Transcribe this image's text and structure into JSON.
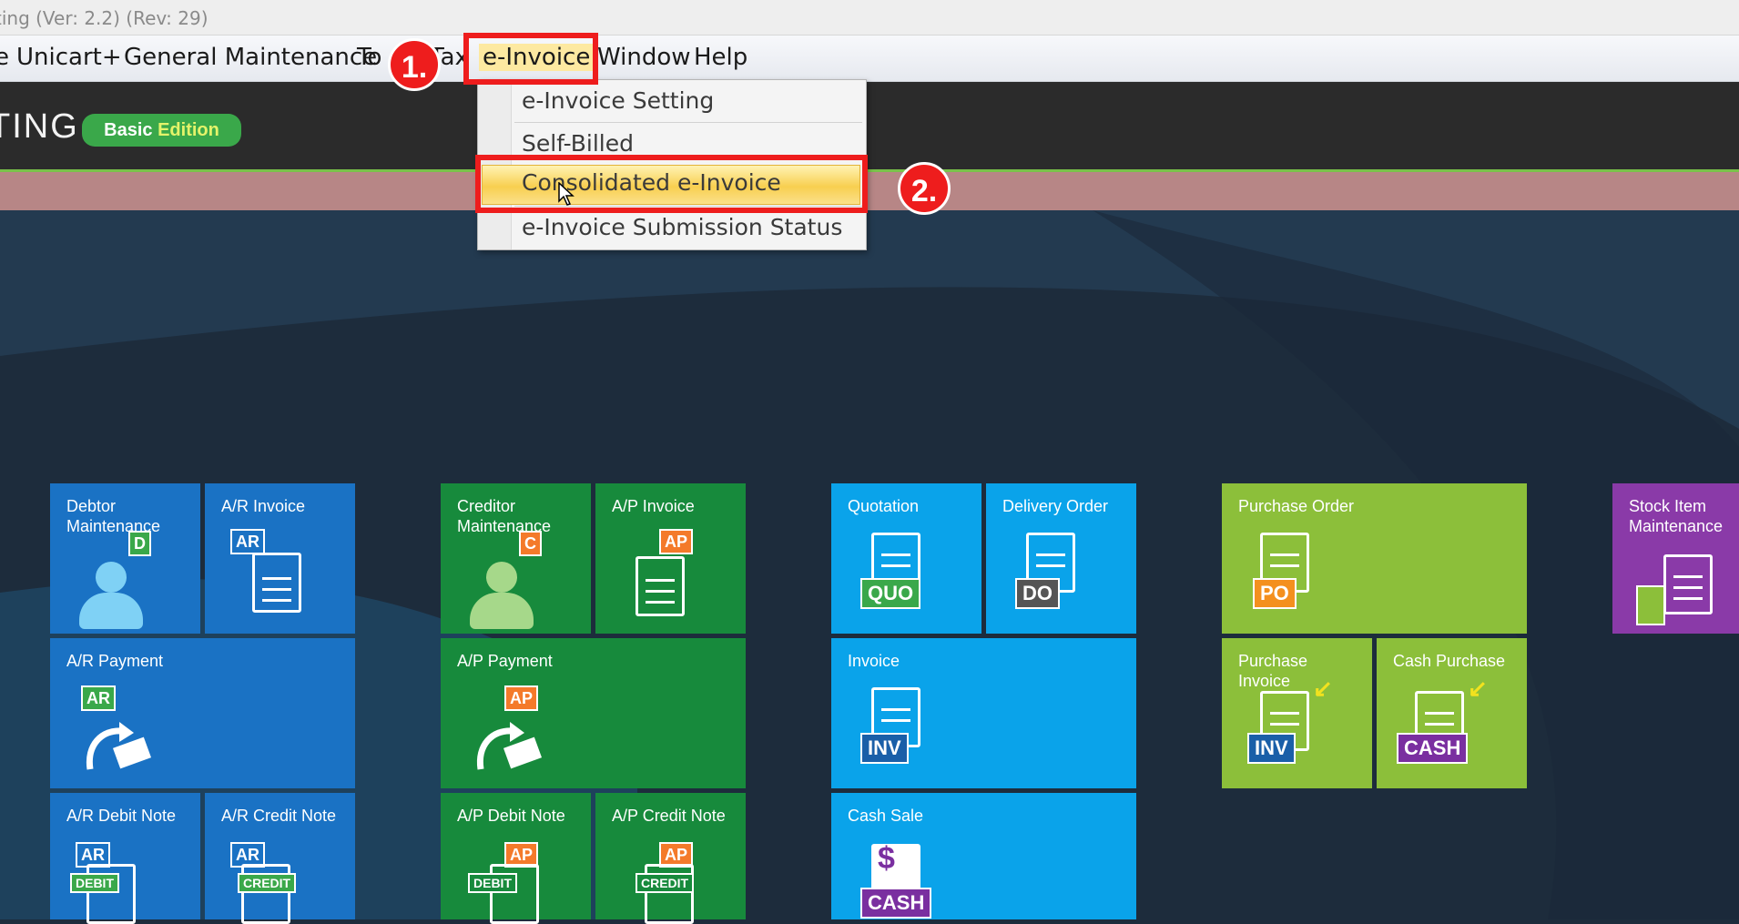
{
  "window": {
    "title": "ting (Ver: 2.2) (Rev: 29)"
  },
  "menu": {
    "items": [
      "e",
      "Unicart+",
      "General Maintenance",
      "To",
      "Tax",
      "e-Invoice",
      "Window",
      "Help"
    ],
    "active": "e-Invoice"
  },
  "header": {
    "logo_text": "TING",
    "badge_part1": "Basic",
    "badge_part2": "Edition"
  },
  "dropdown": {
    "items": [
      "e-Invoice Setting",
      "Self-Billed",
      "Consolidated e-Invoice",
      "e-Invoice Submission Status"
    ],
    "highlighted": "Consolidated e-Invoice"
  },
  "annotations": {
    "step1": "1.",
    "step2": "2."
  },
  "tiles": {
    "debtor": {
      "label": "Debtor Maintenance",
      "tag": "D"
    },
    "ar_invoice": {
      "label": "A/R Invoice",
      "tag": "AR"
    },
    "ar_payment": {
      "label": "A/R Payment",
      "tag": "AR"
    },
    "ar_debit": {
      "label": "A/R Debit Note",
      "tag": "AR",
      "sub": "DEBIT"
    },
    "ar_credit": {
      "label": "A/R Credit Note",
      "tag": "AR",
      "sub": "CREDIT"
    },
    "creditor": {
      "label": "Creditor Maintenance",
      "tag": "C"
    },
    "ap_invoice": {
      "label": "A/P Invoice",
      "tag": "AP"
    },
    "ap_payment": {
      "label": "A/P Payment",
      "tag": "AP"
    },
    "ap_debit": {
      "label": "A/P Debit Note",
      "tag": "AP",
      "sub": "DEBIT"
    },
    "ap_credit": {
      "label": "A/P Credit Note",
      "tag": "AP",
      "sub": "CREDIT"
    },
    "quotation": {
      "label": "Quotation",
      "tag": "QUO"
    },
    "delivery": {
      "label": "Delivery Order",
      "tag": "DO"
    },
    "invoice": {
      "label": "Invoice",
      "tag": "INV"
    },
    "cash_sale": {
      "label": "Cash Sale",
      "tag": "CASH"
    },
    "purchase_order": {
      "label": "Purchase Order",
      "tag": "PO"
    },
    "purchase_invoice": {
      "label": "Purchase Invoice",
      "tag": "INV"
    },
    "cash_purchase": {
      "label": "Cash Purchase",
      "tag": "CASH"
    },
    "stock_item": {
      "label": "Stock Item Maintenance"
    }
  },
  "colors": {
    "ar_blue": "#1a72c4",
    "ap_green": "#178a3c",
    "sales_cyan": "#0aa3ea",
    "purchase_lime": "#8cbf3a",
    "stock_purple": "#8a3aa8",
    "annotation_red": "#ee1d1d",
    "highlight_yellow": "#f8cf50"
  }
}
